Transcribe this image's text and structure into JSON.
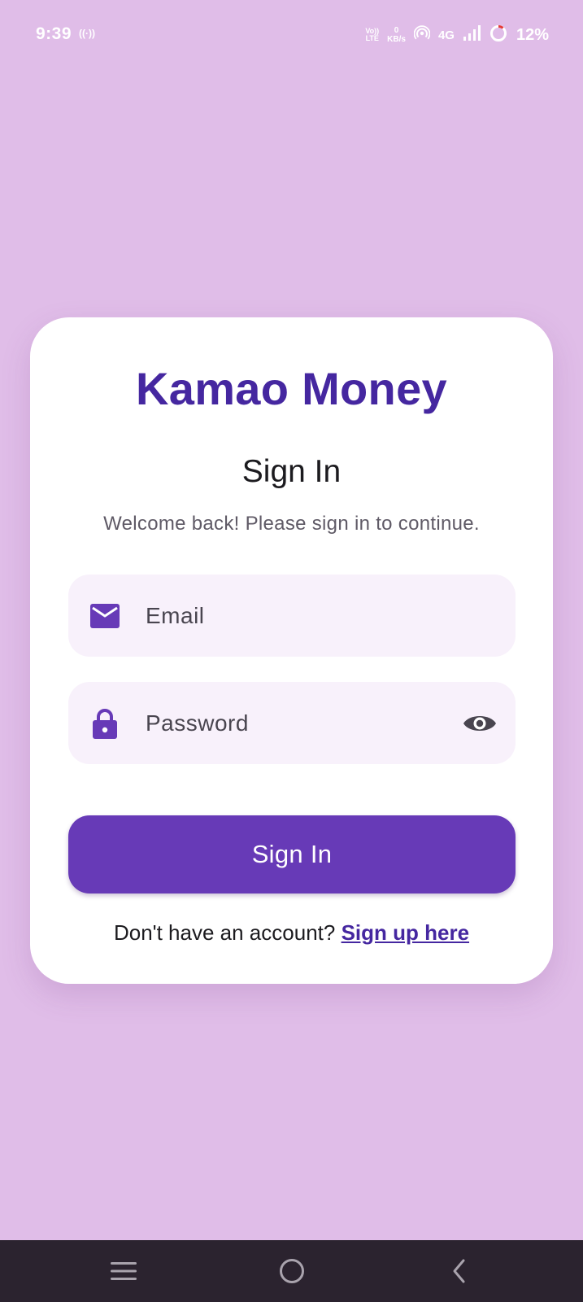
{
  "status_bar": {
    "time": "9:39",
    "hotspot_indicator": "((·))",
    "volte_top": "Vo))",
    "volte_bottom": "LTE",
    "speed_value": "0",
    "speed_unit": "KB/s",
    "network_type": "4G",
    "battery_percent": "12%"
  },
  "card": {
    "app_title": "Kamao Money",
    "page_title": "Sign In",
    "subtitle": "Welcome back! Please sign in to continue.",
    "email_field": {
      "placeholder": "Email",
      "value": "",
      "icon": "mail-icon"
    },
    "password_field": {
      "placeholder": "Password",
      "value": "",
      "icon": "lock-icon",
      "toggle_icon": "eye-icon"
    },
    "signin_button_label": "Sign In",
    "signup_prompt": "Don't have an account?",
    "signup_link": "Sign up here"
  },
  "nav_bar": {
    "icons": [
      "menu-icon",
      "home-circle-icon",
      "back-chevron-icon"
    ]
  },
  "colors": {
    "background": "#e0bde8",
    "brand": "#4527a0",
    "primary_button": "#673ab7",
    "field_background": "#f8f1fb",
    "nav_bar": "#2b232f"
  }
}
